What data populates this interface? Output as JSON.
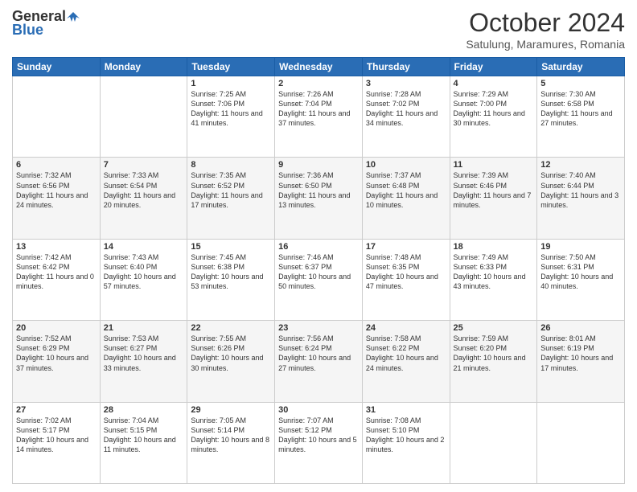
{
  "header": {
    "logo_general": "General",
    "logo_blue": "Blue",
    "month_title": "October 2024",
    "location": "Satulung, Maramures, Romania"
  },
  "days_of_week": [
    "Sunday",
    "Monday",
    "Tuesday",
    "Wednesday",
    "Thursday",
    "Friday",
    "Saturday"
  ],
  "weeks": [
    [
      {
        "day": "",
        "info": ""
      },
      {
        "day": "",
        "info": ""
      },
      {
        "day": "1",
        "info": "Sunrise: 7:25 AM\nSunset: 7:06 PM\nDaylight: 11 hours and 41 minutes."
      },
      {
        "day": "2",
        "info": "Sunrise: 7:26 AM\nSunset: 7:04 PM\nDaylight: 11 hours and 37 minutes."
      },
      {
        "day": "3",
        "info": "Sunrise: 7:28 AM\nSunset: 7:02 PM\nDaylight: 11 hours and 34 minutes."
      },
      {
        "day": "4",
        "info": "Sunrise: 7:29 AM\nSunset: 7:00 PM\nDaylight: 11 hours and 30 minutes."
      },
      {
        "day": "5",
        "info": "Sunrise: 7:30 AM\nSunset: 6:58 PM\nDaylight: 11 hours and 27 minutes."
      }
    ],
    [
      {
        "day": "6",
        "info": "Sunrise: 7:32 AM\nSunset: 6:56 PM\nDaylight: 11 hours and 24 minutes."
      },
      {
        "day": "7",
        "info": "Sunrise: 7:33 AM\nSunset: 6:54 PM\nDaylight: 11 hours and 20 minutes."
      },
      {
        "day": "8",
        "info": "Sunrise: 7:35 AM\nSunset: 6:52 PM\nDaylight: 11 hours and 17 minutes."
      },
      {
        "day": "9",
        "info": "Sunrise: 7:36 AM\nSunset: 6:50 PM\nDaylight: 11 hours and 13 minutes."
      },
      {
        "day": "10",
        "info": "Sunrise: 7:37 AM\nSunset: 6:48 PM\nDaylight: 11 hours and 10 minutes."
      },
      {
        "day": "11",
        "info": "Sunrise: 7:39 AM\nSunset: 6:46 PM\nDaylight: 11 hours and 7 minutes."
      },
      {
        "day": "12",
        "info": "Sunrise: 7:40 AM\nSunset: 6:44 PM\nDaylight: 11 hours and 3 minutes."
      }
    ],
    [
      {
        "day": "13",
        "info": "Sunrise: 7:42 AM\nSunset: 6:42 PM\nDaylight: 11 hours and 0 minutes."
      },
      {
        "day": "14",
        "info": "Sunrise: 7:43 AM\nSunset: 6:40 PM\nDaylight: 10 hours and 57 minutes."
      },
      {
        "day": "15",
        "info": "Sunrise: 7:45 AM\nSunset: 6:38 PM\nDaylight: 10 hours and 53 minutes."
      },
      {
        "day": "16",
        "info": "Sunrise: 7:46 AM\nSunset: 6:37 PM\nDaylight: 10 hours and 50 minutes."
      },
      {
        "day": "17",
        "info": "Sunrise: 7:48 AM\nSunset: 6:35 PM\nDaylight: 10 hours and 47 minutes."
      },
      {
        "day": "18",
        "info": "Sunrise: 7:49 AM\nSunset: 6:33 PM\nDaylight: 10 hours and 43 minutes."
      },
      {
        "day": "19",
        "info": "Sunrise: 7:50 AM\nSunset: 6:31 PM\nDaylight: 10 hours and 40 minutes."
      }
    ],
    [
      {
        "day": "20",
        "info": "Sunrise: 7:52 AM\nSunset: 6:29 PM\nDaylight: 10 hours and 37 minutes."
      },
      {
        "day": "21",
        "info": "Sunrise: 7:53 AM\nSunset: 6:27 PM\nDaylight: 10 hours and 33 minutes."
      },
      {
        "day": "22",
        "info": "Sunrise: 7:55 AM\nSunset: 6:26 PM\nDaylight: 10 hours and 30 minutes."
      },
      {
        "day": "23",
        "info": "Sunrise: 7:56 AM\nSunset: 6:24 PM\nDaylight: 10 hours and 27 minutes."
      },
      {
        "day": "24",
        "info": "Sunrise: 7:58 AM\nSunset: 6:22 PM\nDaylight: 10 hours and 24 minutes."
      },
      {
        "day": "25",
        "info": "Sunrise: 7:59 AM\nSunset: 6:20 PM\nDaylight: 10 hours and 21 minutes."
      },
      {
        "day": "26",
        "info": "Sunrise: 8:01 AM\nSunset: 6:19 PM\nDaylight: 10 hours and 17 minutes."
      }
    ],
    [
      {
        "day": "27",
        "info": "Sunrise: 7:02 AM\nSunset: 5:17 PM\nDaylight: 10 hours and 14 minutes."
      },
      {
        "day": "28",
        "info": "Sunrise: 7:04 AM\nSunset: 5:15 PM\nDaylight: 10 hours and 11 minutes."
      },
      {
        "day": "29",
        "info": "Sunrise: 7:05 AM\nSunset: 5:14 PM\nDaylight: 10 hours and 8 minutes."
      },
      {
        "day": "30",
        "info": "Sunrise: 7:07 AM\nSunset: 5:12 PM\nDaylight: 10 hours and 5 minutes."
      },
      {
        "day": "31",
        "info": "Sunrise: 7:08 AM\nSunset: 5:10 PM\nDaylight: 10 hours and 2 minutes."
      },
      {
        "day": "",
        "info": ""
      },
      {
        "day": "",
        "info": ""
      }
    ]
  ]
}
